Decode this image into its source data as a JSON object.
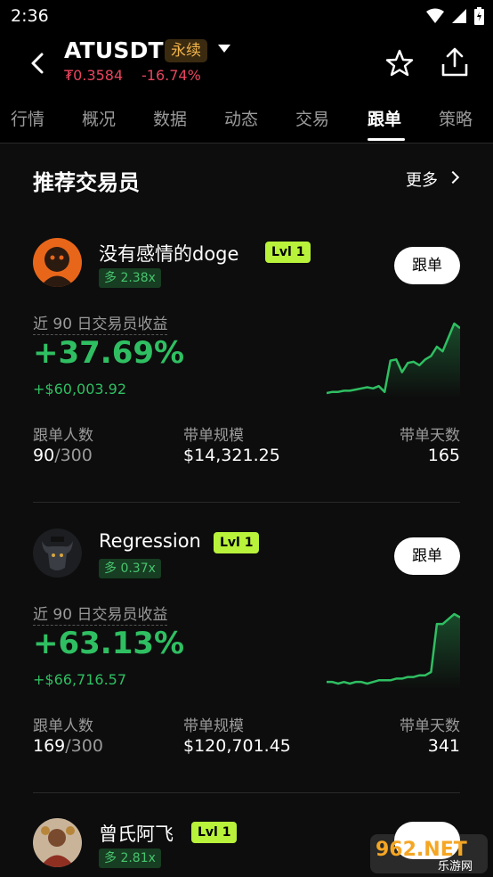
{
  "status_bar": {
    "time": "2:36"
  },
  "header": {
    "pair": "ATUSDT",
    "contract_type": "永续",
    "price": "₮0.3584",
    "change": "-16.74%"
  },
  "tabs": [
    "行情",
    "概况",
    "数据",
    "动态",
    "交易",
    "跟单",
    "策略"
  ],
  "active_tab": "跟单",
  "section": {
    "title": "推荐交易员",
    "more": "更多"
  },
  "traders": [
    {
      "name": "没有感情的doge",
      "level": "Lvl 1",
      "leverage": "多 2.38x",
      "button": "跟单",
      "pnl_label": "近 90 日交易员收益",
      "pnl_pct": "+37.69%",
      "pnl_abs": "+$60,003.92",
      "followers_label": "跟单人数",
      "followers": "90",
      "followers_max": "/300",
      "aum_label": "带单规模",
      "aum": "$14,321.25",
      "days_label": "带单天数",
      "days": "165",
      "trend": [
        4,
        5,
        5,
        6,
        6,
        7,
        8,
        9,
        8,
        10,
        5,
        32,
        33,
        22,
        30,
        31,
        28,
        33,
        36,
        44,
        40,
        52,
        64,
        60
      ]
    },
    {
      "name": "Regression",
      "level": "Lvl 1",
      "leverage": "多 0.37x",
      "button": "跟单",
      "pnl_label": "近 90 日交易员收益",
      "pnl_pct": "+63.13%",
      "pnl_abs": "+$66,716.57",
      "followers_label": "跟单人数",
      "followers": "169",
      "followers_max": "/300",
      "aum_label": "带单规模",
      "aum": "$120,701.45",
      "days_label": "带单天数",
      "days": "341",
      "trend": [
        3,
        3,
        2,
        3,
        2,
        3,
        3,
        2,
        3,
        4,
        4,
        4,
        5,
        5,
        6,
        6,
        7,
        7,
        9,
        38,
        38,
        41,
        44,
        42
      ]
    },
    {
      "name": "曾氏阿飞",
      "level": "Lvl 1",
      "leverage": "多 2.81x"
    }
  ],
  "colors": {
    "positive": "#2fbf62",
    "negative": "#e8455e",
    "level_badge": "#b8f23a",
    "perp_badge_text": "#f0b34a"
  },
  "watermark": {
    "text": "962.NET",
    "subtext": "乐游网"
  }
}
